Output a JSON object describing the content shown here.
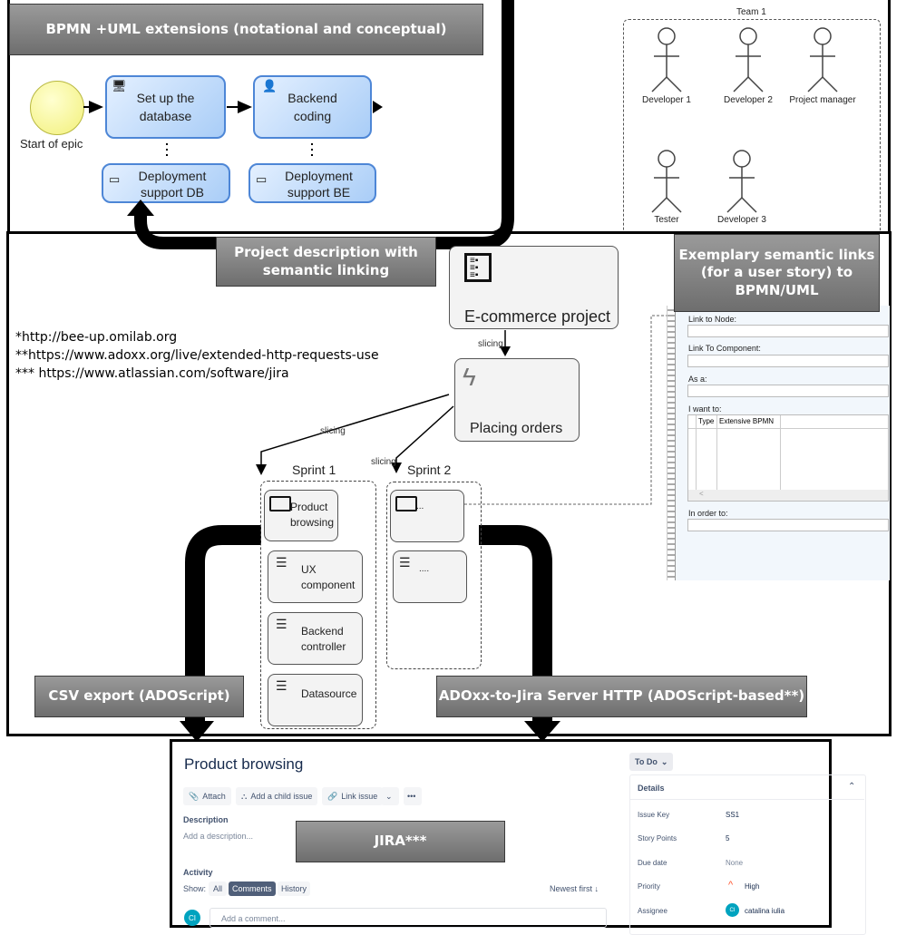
{
  "top_left_panel": {
    "callout": "BPMN +UML extensions (notational and conceptual)",
    "start_event_label": "Start of epic",
    "tasks": [
      {
        "label_line1": "Set up the",
        "label_line2": "database",
        "icon": "database-setup-icon"
      },
      {
        "label_line1": "Backend",
        "label_line2": "coding",
        "icon": "user-worker-icon"
      }
    ],
    "deployment_tasks": [
      {
        "label_line1": "Deployment",
        "label_line2": "support DB",
        "icon": "monitor-icon"
      },
      {
        "label_line1": "Deployment",
        "label_line2": "support BE",
        "icon": "monitor-icon"
      }
    ]
  },
  "team_panel": {
    "title": "Team 1",
    "actors": [
      "Developer 1",
      "Developer 2",
      "Project manager",
      "Tester",
      "Developer 3"
    ]
  },
  "middle_panel": {
    "callout_project": "Project description with semantic linking",
    "callout_links": "Exemplary semantic links (for a user story) to BPMN/UML",
    "footnotes": [
      "*http://bee-up.omilab.org",
      "**https://www.adoxx.org/live/extended-http-requests-use",
      "*** https://www.atlassian.com/software/jira"
    ],
    "project_node": "E-commerce project",
    "epic_node": "Placing orders",
    "relation_label": "slicing",
    "sprints": [
      {
        "title": "Sprint 1",
        "items": [
          "Product browsing",
          "UX component",
          "Backend controller",
          "Datasource"
        ]
      },
      {
        "title": "Sprint 2",
        "items": [
          "...",
          "...."
        ]
      }
    ],
    "form": {
      "link_to_node": "Link to Node:",
      "link_to_component": "Link To Component:",
      "as_a": "As a:",
      "i_want_to": "I want to:",
      "table_headers": [
        "Type",
        "Extensive BPMN"
      ],
      "scroll_left": "<",
      "in_order_to": "In order to:"
    },
    "callout_csv": "CSV export (ADOScript)",
    "callout_http": "ADOxx-to-Jira Server HTTP (ADOScript-based**)"
  },
  "jira": {
    "callout": "JIRA***",
    "issue_title": "Product browsing",
    "toolbar": {
      "attach": "Attach",
      "add_child": "Add a child issue",
      "link_issue": "Link issue",
      "more": "•••"
    },
    "description_label": "Description",
    "description_placeholder": "Add a description...",
    "activity_label": "Activity",
    "show_label": "Show:",
    "filters": [
      "All",
      "Comments",
      "History"
    ],
    "active_filter": "Comments",
    "sort": "Newest first ↓",
    "comment_placeholder": "Add a comment...",
    "avatar_initials": "CI",
    "status": "To Do",
    "details_title": "Details",
    "details": [
      {
        "label": "Issue Key",
        "value": "SS1"
      },
      {
        "label": "Story Points",
        "value": "5"
      },
      {
        "label": "Due date",
        "value": "None"
      },
      {
        "label": "Priority",
        "value": "High"
      },
      {
        "label": "Assignee",
        "value": "catalina iulia"
      }
    ],
    "colors": {
      "accent": "#42526e",
      "avatar": "#00a3bf",
      "priority_high": "#ff5630"
    }
  }
}
